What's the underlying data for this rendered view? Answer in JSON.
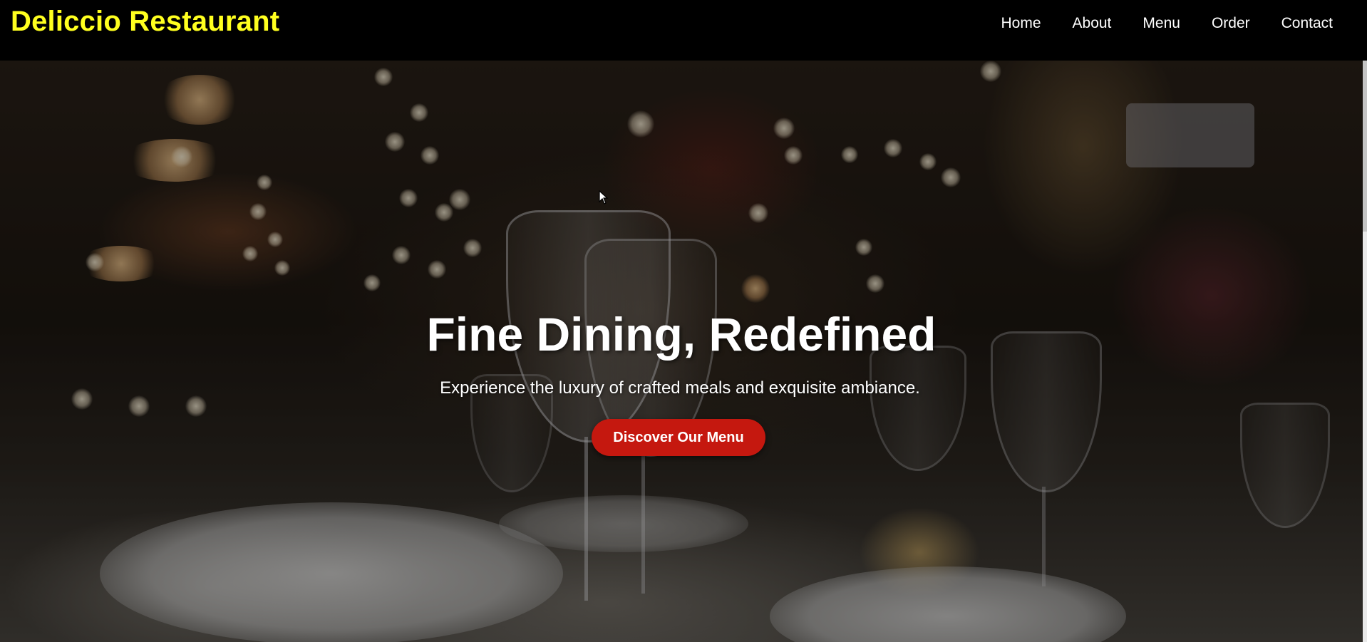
{
  "header": {
    "brand": "Deliccio Restaurant",
    "nav": [
      {
        "label": "Home"
      },
      {
        "label": "About"
      },
      {
        "label": "Menu"
      },
      {
        "label": "Order"
      },
      {
        "label": "Contact"
      }
    ]
  },
  "hero": {
    "title": "Fine Dining, Redefined",
    "subtitle": "Experience the luxury of crafted meals and exquisite ambiance.",
    "cta_label": "Discover Our Menu",
    "background_icon": "restaurant-table-photo"
  },
  "colors": {
    "brand": "#ffff1f",
    "cta": "#c5180f",
    "header_bg": "#000000",
    "text": "#ffffff"
  }
}
